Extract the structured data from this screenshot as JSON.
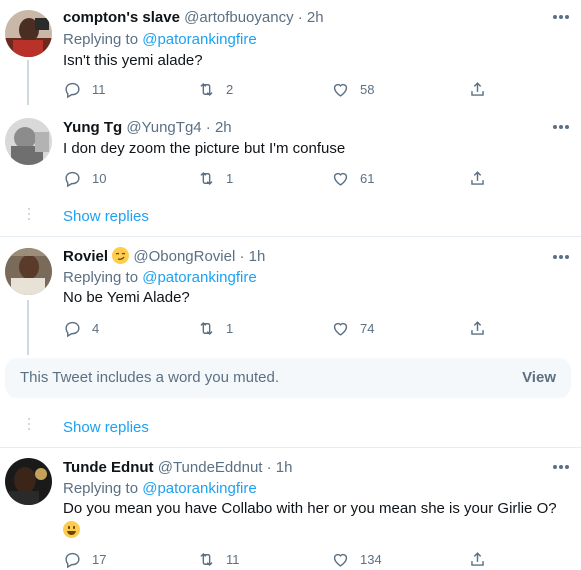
{
  "replies": [
    {
      "name": "compton's slave",
      "handle": "@artofbuoyancy",
      "time": "· 2h",
      "replying_label": "Replying to",
      "replying_to": "@patorankingfire",
      "text": "Isn't this yemi alade?",
      "replies": "11",
      "retweets": "2",
      "likes": "58"
    },
    {
      "name": "Yung Tg",
      "handle": "@YungTg4",
      "time": "· 2h",
      "text": "I don dey zoom the picture but I'm confuse",
      "replies": "10",
      "retweets": "1",
      "likes": "61",
      "show_replies": "Show replies"
    },
    {
      "name": "Roviel",
      "name_emoji": "smirking-face",
      "handle": "@ObongRoviel",
      "time": "· 1h",
      "replying_label": "Replying to",
      "replying_to": "@patorankingfire",
      "text": "No be Yemi Alade?",
      "replies": "4",
      "retweets": "1",
      "likes": "74"
    },
    {
      "name": "Tunde Ednut",
      "handle": "@TundeEddnut",
      "time": "· 1h",
      "replying_label": "Replying to",
      "replying_to": "@patorankingfire",
      "text": "Do you mean you have Collabo with her or you mean she is your Girlie O?",
      "text_emoji": "grinning-face",
      "replies": "17",
      "retweets": "11",
      "likes": "134"
    }
  ],
  "muted": {
    "text": "This Tweet includes a word you muted.",
    "action": "View"
  },
  "show_replies_2": "Show replies",
  "colors": {
    "link": "#1da1f2",
    "secondary": "#5b7083",
    "muted_bg": "#f5f8fa",
    "divider": "#e6ecf0"
  }
}
